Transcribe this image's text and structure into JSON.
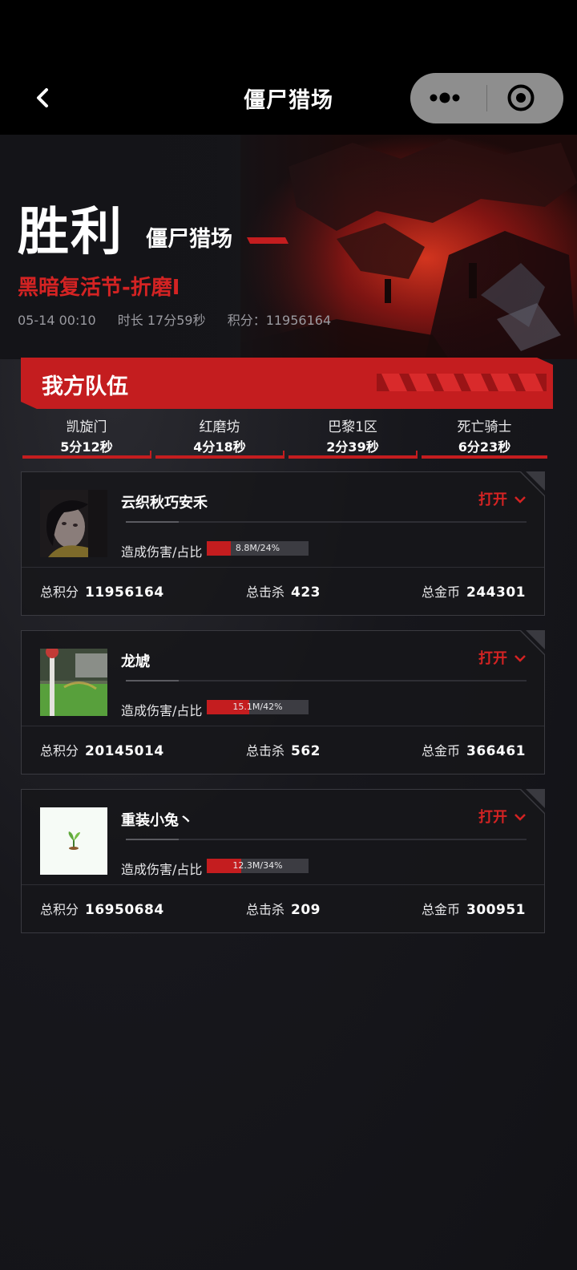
{
  "nav": {
    "title": "僵尸猎场",
    "back_icon": "chevron-left-icon",
    "more_icon": "more-dots-icon",
    "close_icon": "target-circle-icon"
  },
  "hero": {
    "result": "胜利",
    "mode": "僵尸猎场",
    "event": "黑暗复活节-折磨I",
    "date": "05-14 00:10",
    "duration": "时长 17分59秒",
    "score": "积分：11956164"
  },
  "team": {
    "title": "我方队伍",
    "stages": [
      {
        "name": "凯旋门",
        "time": "5分12秒"
      },
      {
        "name": "红磨坊",
        "time": "4分18秒"
      },
      {
        "name": "巴黎1区",
        "time": "2分39秒"
      },
      {
        "name": "死亡骑士",
        "time": "6分23秒"
      }
    ]
  },
  "labels": {
    "open": "打开",
    "damage": "造成伤害/占比",
    "total_score": "总积分",
    "total_kills": "总击杀",
    "total_gold": "总金币"
  },
  "players": [
    {
      "name": "云织秋巧安禾",
      "damage": "8.8M/24%",
      "damage_pct": 24,
      "score": "11956164",
      "kills": "423",
      "gold": "244301",
      "avatar": "portrait-photo"
    },
    {
      "name": "龙虓",
      "damage": "15.1M/42%",
      "damage_pct": 42,
      "score": "20145014",
      "kills": "562",
      "gold": "366461",
      "avatar": "garden-photo"
    },
    {
      "name": "重装小兔丶",
      "damage": "12.3M/34%",
      "damage_pct": 34,
      "score": "16950684",
      "kills": "209",
      "gold": "300951",
      "avatar": "sprout-icon"
    }
  ],
  "colors": {
    "accent": "#c41d1f",
    "accent_text": "#d42323",
    "background": "#141418",
    "topbar": "#000000",
    "capsule": "#8e8e8e"
  }
}
